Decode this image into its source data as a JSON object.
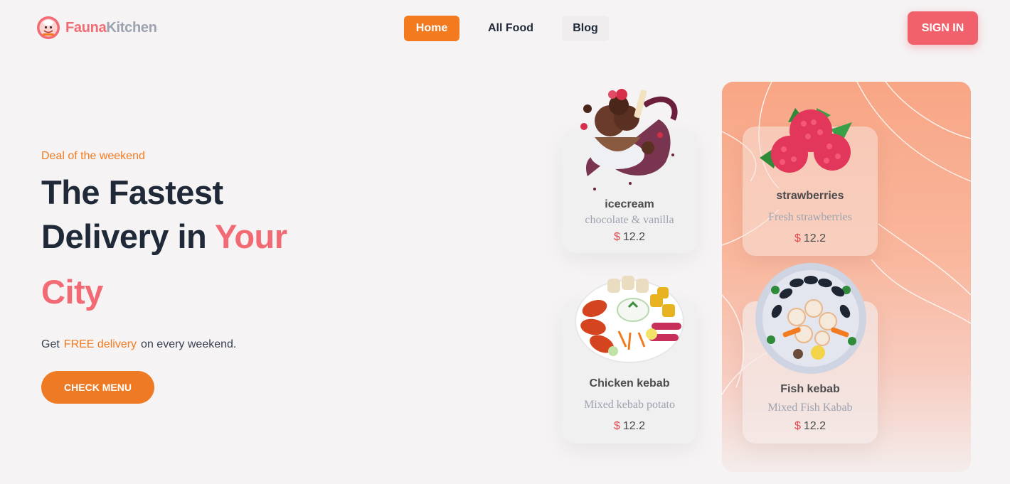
{
  "brand": {
    "name_part1": "Fauna",
    "name_part2": "Kitchen",
    "logo_icon": "chef-logo-icon"
  },
  "nav": {
    "items": [
      {
        "label": "Home",
        "active": true
      },
      {
        "label": "All Food",
        "active": false
      },
      {
        "label": "Blog",
        "active": false
      }
    ]
  },
  "auth": {
    "signin_label": "SIGN IN"
  },
  "hero": {
    "eyebrow": "Deal of the weekend",
    "headline_line1": "The Fastest",
    "headline_line2_prefix": "Delivery in",
    "headline_line2_accent": "Your",
    "headline_line3": "City",
    "sub_prefix": "Get",
    "sub_highlight": "FREE delivery",
    "sub_suffix": "on every weekend.",
    "cta_label": "CHECK MENU"
  },
  "cards": [
    {
      "name": "icecream",
      "description": "chocolate & vanilla",
      "currency": "$",
      "price": "12.2",
      "image": "icecream-image"
    },
    {
      "name": "strawberries",
      "description": "Fresh strawberries",
      "currency": "$",
      "price": "12.2",
      "image": "raspberry-image"
    },
    {
      "name": "Chicken kebab",
      "description": "Mixed kebab potato",
      "currency": "$",
      "price": "12.2",
      "image": "chicken-kebab-image"
    },
    {
      "name": "Fish kebab",
      "description": "Mixed Fish Kabab",
      "currency": "$",
      "price": "12.2",
      "image": "fish-kebab-image"
    }
  ],
  "colors": {
    "accent_orange": "#f47a1f",
    "accent_pink": "#f26b74",
    "signin": "#f0616b",
    "price_currency": "#e5484d"
  }
}
